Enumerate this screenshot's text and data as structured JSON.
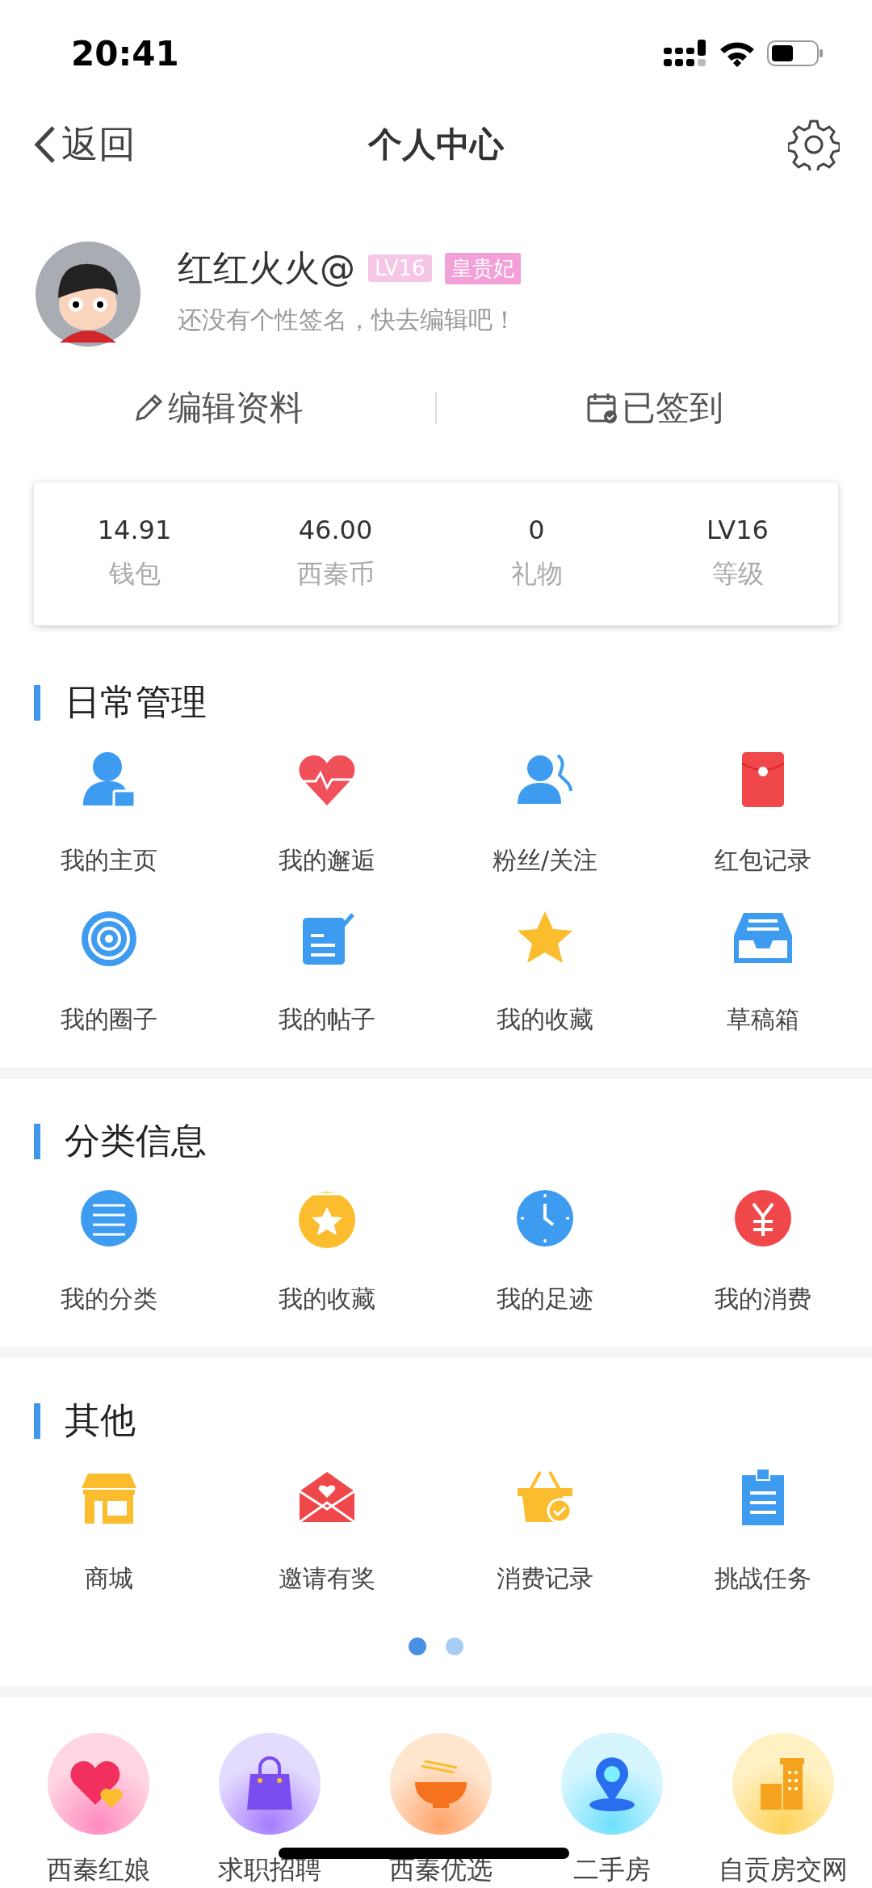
{
  "status_bar": {
    "time": "20:41"
  },
  "nav": {
    "back": "返回",
    "title": "个人中心"
  },
  "profile": {
    "name": "红红火火@",
    "level_badge": "LV16",
    "title_badge": "皇贵妃",
    "signature": "还没有个性签名，快去编辑吧！"
  },
  "actions": [
    {
      "label": "编辑资料"
    },
    {
      "label": "已签到"
    }
  ],
  "stats": [
    {
      "value": "14.91",
      "label": "钱包"
    },
    {
      "value": "46.00",
      "label": "西秦币"
    },
    {
      "value": "0",
      "label": "礼物"
    },
    {
      "value": "LV16",
      "label": "等级"
    }
  ],
  "sections": [
    {
      "title": "日常管理",
      "items": [
        {
          "label": "我的主页"
        },
        {
          "label": "我的邂逅"
        },
        {
          "label": "粉丝/关注"
        },
        {
          "label": "红包记录"
        },
        {
          "label": "我的圈子"
        },
        {
          "label": "我的帖子"
        },
        {
          "label": "我的收藏"
        },
        {
          "label": "草稿箱"
        }
      ]
    },
    {
      "title": "分类信息",
      "items": [
        {
          "label": "我的分类"
        },
        {
          "label": "我的收藏"
        },
        {
          "label": "我的足迹"
        },
        {
          "label": "我的消费"
        }
      ]
    },
    {
      "title": "其他",
      "items": [
        {
          "label": "商城"
        },
        {
          "label": "邀请有奖"
        },
        {
          "label": "消费记录"
        },
        {
          "label": "挑战任务"
        }
      ],
      "pages": [
        {
          "selected": true
        },
        {
          "selected": false
        }
      ]
    }
  ],
  "services": [
    {
      "label": "西秦红娘"
    },
    {
      "label": "求职招聘"
    },
    {
      "label": "西秦优选"
    },
    {
      "label": "二手房"
    },
    {
      "label": "自贡房交网"
    }
  ]
}
